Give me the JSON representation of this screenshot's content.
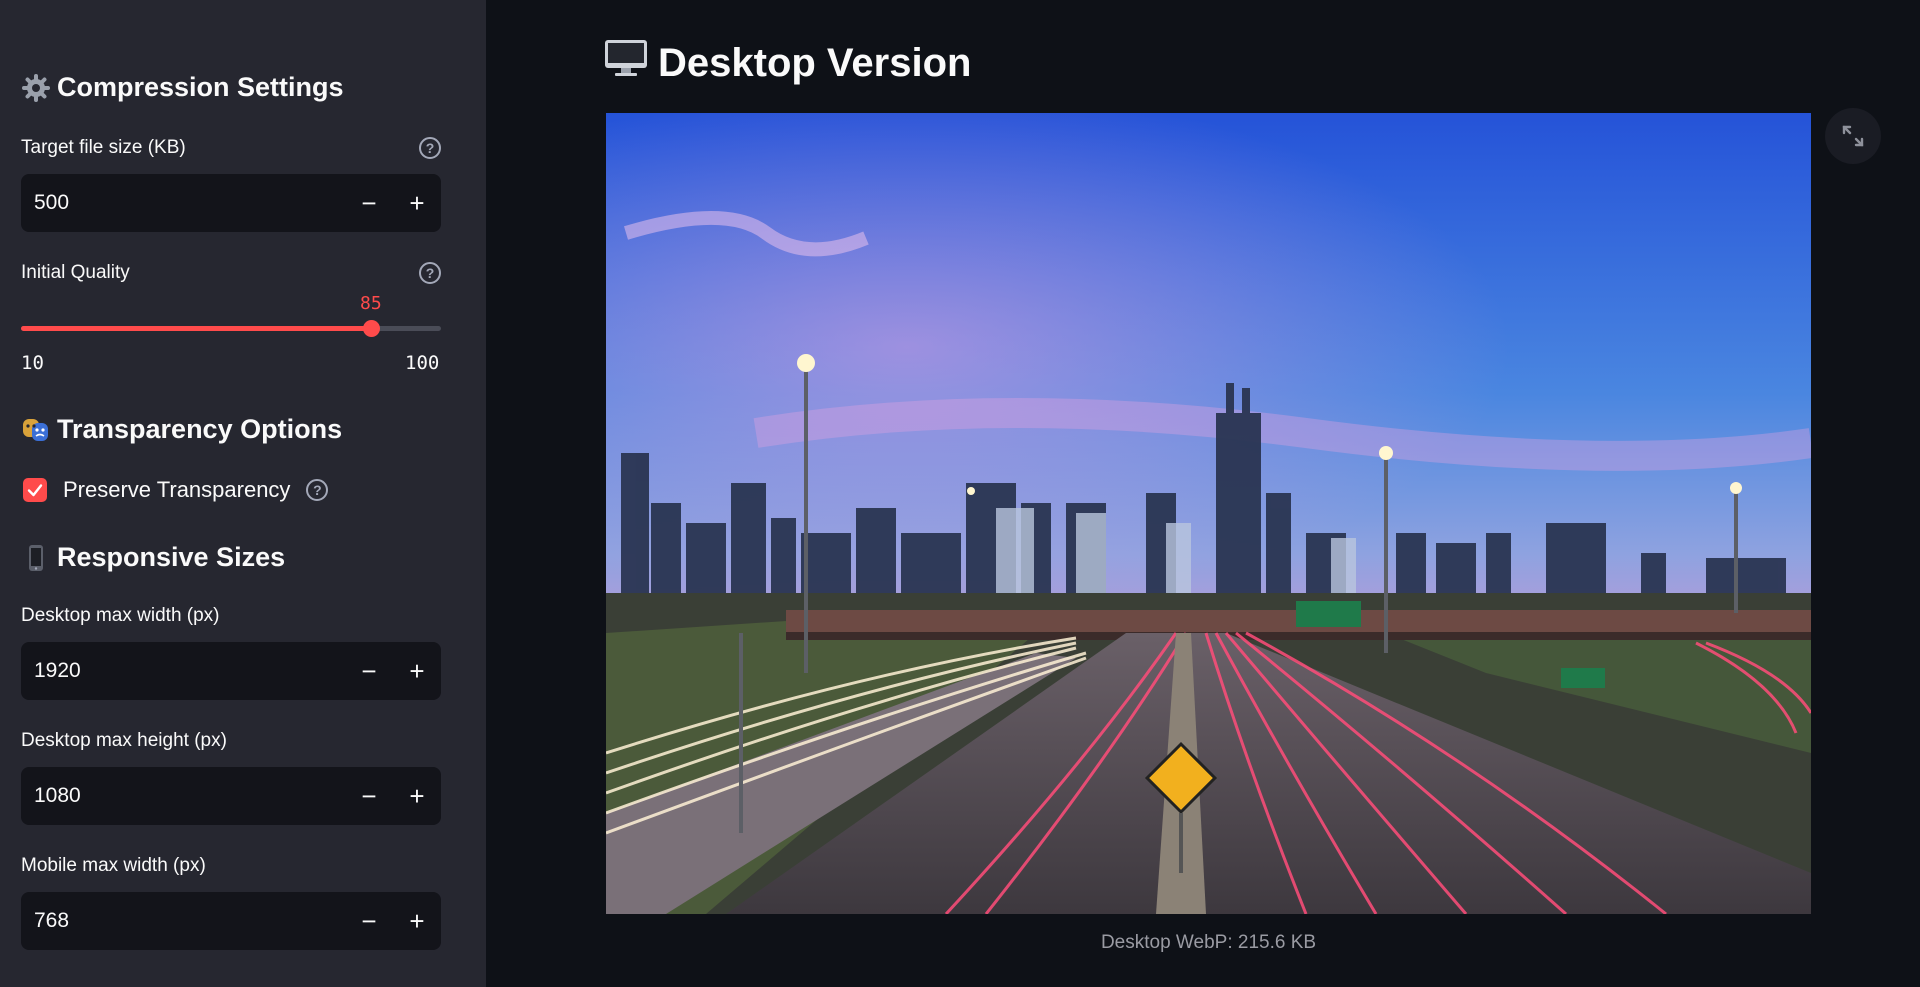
{
  "sidebar": {
    "compression": {
      "title": "Compression Settings",
      "target_size": {
        "label": "Target file size (KB)",
        "value": "500"
      },
      "quality": {
        "label": "Initial Quality",
        "value": "85",
        "min": "10",
        "max": "100",
        "fraction": 0.833
      }
    },
    "transparency": {
      "title": "Transparency Options",
      "preserve": {
        "label": "Preserve Transparency",
        "checked": true
      }
    },
    "responsive": {
      "title": "Responsive Sizes",
      "desktop_width": {
        "label": "Desktop max width (px)",
        "value": "1920"
      },
      "desktop_height": {
        "label": "Desktop max height (px)",
        "value": "1080"
      },
      "mobile_width": {
        "label": "Mobile max width (px)",
        "value": "768"
      }
    },
    "stepper": {
      "minus": "−",
      "plus": "+"
    }
  },
  "main": {
    "title": "Desktop Version",
    "caption": "Desktop WebP: 215.6 KB"
  },
  "colors": {
    "accent": "#ff4b4b",
    "sidebar_bg": "#262730",
    "main_bg": "#0e1117"
  },
  "icons": [
    "gear-icon",
    "theater-masks-icon",
    "mobile-phone-icon",
    "desktop-computer-icon",
    "help-icon",
    "check-icon",
    "fullscreen-icon"
  ]
}
